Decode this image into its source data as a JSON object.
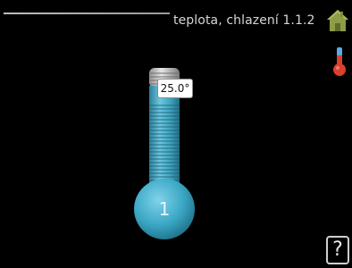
{
  "header": {
    "title": "teplota, chlazení 1.1.2"
  },
  "icons": {
    "home": "home-icon",
    "thermometer": "thermometer-icon",
    "help": "help-icon"
  },
  "thermometer": {
    "value_label": "25.0°",
    "bulb_label": "1"
  },
  "help": {
    "label": "?"
  },
  "colors": {
    "background": "#000000",
    "bulb_blue": "#3aa6c4",
    "home_green": "#8a9a4a",
    "thermo_red": "#d9402e"
  }
}
